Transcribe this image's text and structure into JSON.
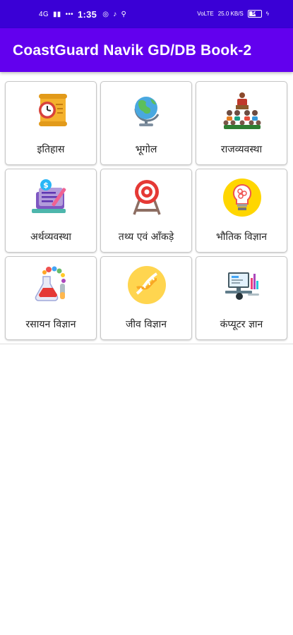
{
  "status_bar": {
    "network": "4G",
    "time": "1:35",
    "speed_value": "25.0",
    "speed_unit": "KB/S",
    "volte": "VoLTE",
    "battery": "56"
  },
  "app_bar": {
    "title": "CoastGuard Navik GD/DB Book-2"
  },
  "categories": [
    {
      "label": "इतिहास",
      "icon": "scroll-clock-icon"
    },
    {
      "label": "भूगोल",
      "icon": "globe-icon"
    },
    {
      "label": "राजव्यवस्था",
      "icon": "assembly-speaker-icon"
    },
    {
      "label": "अर्थव्यवस्था",
      "icon": "finance-document-icon"
    },
    {
      "label": "तथ्य एवं आँकड़े",
      "icon": "target-icon"
    },
    {
      "label": "भौतिक विज्ञान",
      "icon": "lightbulb-icon"
    },
    {
      "label": "रसायन विज्ञान",
      "icon": "lab-flask-icon"
    },
    {
      "label": "जीव विज्ञान",
      "icon": "dna-icon"
    },
    {
      "label": "कंप्यूटर ज्ञान",
      "icon": "computer-icon"
    }
  ],
  "colors": {
    "status_bar": "#3a00d6",
    "app_bar": "#6200ee",
    "tile_border": "#c7c7c7"
  }
}
